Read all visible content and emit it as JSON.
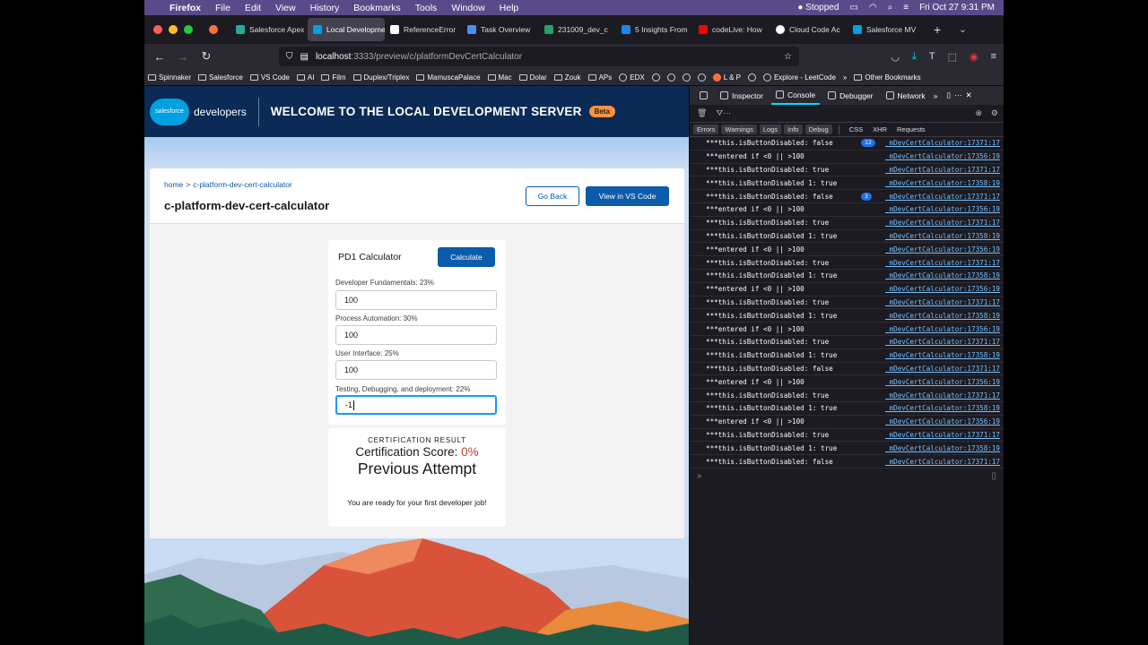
{
  "menubar": {
    "app": "Firefox",
    "items": [
      "File",
      "Edit",
      "View",
      "History",
      "Bookmarks",
      "Tools",
      "Window",
      "Help"
    ],
    "status": "Stopped",
    "clock": "Fri Oct 27  9:31 PM"
  },
  "tabs": [
    {
      "label": "Salesforce Apex",
      "color": "#2aa89b"
    },
    {
      "label": "Local Development",
      "color": "#00a1e0",
      "active": true
    },
    {
      "label": "ReferenceError",
      "color": "#ffffff"
    },
    {
      "label": "Task Overview",
      "color": "#4c8df6"
    },
    {
      "label": "231009_dev_c",
      "color": "#21a366"
    },
    {
      "label": "5 Insights From",
      "color": "#1e88e5"
    },
    {
      "label": "codeLive: How",
      "color": "#ff0000"
    },
    {
      "label": "Cloud Code Ac",
      "color": "#ffffff"
    },
    {
      "label": "Salesforce MV",
      "color": "#00a1e0"
    }
  ],
  "url": {
    "host": "localhost",
    "rest": ":3333/preview/c/platformDevCertCalculator"
  },
  "bookmarks": [
    "Spinnaker",
    "Salesforce",
    "VS Code",
    "AI",
    "Film",
    "Duplex/Triplex",
    "MamuscaPalace",
    "Mac",
    "Dolar",
    "Zouk",
    "APs",
    "EDX",
    "L & P",
    "Explore - LeetCode",
    "Other Bookmarks"
  ],
  "header": {
    "logo": "salesforce",
    "brand": "developers",
    "welcome": "WELCOME TO THE LOCAL DEVELOPMENT SERVER",
    "beta": "Beta"
  },
  "card": {
    "crumb_home": "home",
    "crumb_page": "c-platform-dev-cert-calculator",
    "title": "c-platform-dev-cert-calculator",
    "go_back": "Go Back",
    "view_vscode": "View in VS Code"
  },
  "calculator": {
    "title": "PD1 Calculator",
    "button": "Calculate",
    "fields": [
      {
        "label": "Developer Fundamentals: 23%",
        "value": "100"
      },
      {
        "label": "Process Automation: 30%",
        "value": "100"
      },
      {
        "label": "User Interface: 25%",
        "value": "100"
      },
      {
        "label": "Testing, Debugging, and deployment: 22%",
        "value": "-1"
      }
    ]
  },
  "result": {
    "heading": "CERTIFICATION RESULT",
    "score_label": "Certification Score:",
    "score_value": "0%",
    "attempt": "Previous Attempt",
    "message": "You are ready for your first developer job!"
  },
  "devtools": {
    "tabs": [
      "Inspector",
      "Console",
      "Debugger",
      "Network"
    ],
    "active_tab": "Console",
    "levels": [
      "Errors",
      "Warnings",
      "Logs",
      "Info",
      "Debug",
      "CSS",
      "XHR",
      "Requests"
    ],
    "logs": [
      {
        "msg": "***this.isButtonDisabled: false",
        "count": "12",
        "src": "_mDevCertCalculator:17371:17"
      },
      {
        "msg": "***entered if <0 || >100",
        "src": "_mDevCertCalculator:17356:19"
      },
      {
        "msg": "***this.isButtonDisabled: true",
        "src": "_mDevCertCalculator:17371:17"
      },
      {
        "msg": "***this.isButtonDisabled 1: true",
        "src": "_mDevCertCalculator:17358:19"
      },
      {
        "msg": "***this.isButtonDisabled: false",
        "count": "3",
        "src": "_mDevCertCalculator:17371:17"
      },
      {
        "msg": "***entered if <0 || >100",
        "src": "_mDevCertCalculator:17356:19"
      },
      {
        "msg": "***this.isButtonDisabled: true",
        "src": "_mDevCertCalculator:17371:17"
      },
      {
        "msg": "***this.isButtonDisabled 1: true",
        "src": "_mDevCertCalculator:17358:19"
      },
      {
        "msg": "***entered if <0 || >100",
        "src": "_mDevCertCalculator:17356:19"
      },
      {
        "msg": "***this.isButtonDisabled: true",
        "src": "_mDevCertCalculator:17371:17"
      },
      {
        "msg": "***this.isButtonDisabled 1: true",
        "src": "_mDevCertCalculator:17358:19"
      },
      {
        "msg": "***entered if <0 || >100",
        "src": "_mDevCertCalculator:17356:19"
      },
      {
        "msg": "***this.isButtonDisabled: true",
        "src": "_mDevCertCalculator:17371:17"
      },
      {
        "msg": "***this.isButtonDisabled 1: true",
        "src": "_mDevCertCalculator:17358:19"
      },
      {
        "msg": "***entered if <0 || >100",
        "src": "_mDevCertCalculator:17356:19"
      },
      {
        "msg": "***this.isButtonDisabled: true",
        "src": "_mDevCertCalculator:17371:17"
      },
      {
        "msg": "***this.isButtonDisabled 1: true",
        "src": "_mDevCertCalculator:17358:19"
      },
      {
        "msg": "***this.isButtonDisabled: false",
        "src": "_mDevCertCalculator:17371:17"
      },
      {
        "msg": "***entered if <0 || >100",
        "src": "_mDevCertCalculator:17356:19"
      },
      {
        "msg": "***this.isButtonDisabled: true",
        "src": "_mDevCertCalculator:17371:17"
      },
      {
        "msg": "***this.isButtonDisabled 1: true",
        "src": "_mDevCertCalculator:17358:19"
      },
      {
        "msg": "***entered if <0 || >100",
        "src": "_mDevCertCalculator:17356:19"
      },
      {
        "msg": "***this.isButtonDisabled: true",
        "src": "_mDevCertCalculator:17371:17"
      },
      {
        "msg": "***this.isButtonDisabled 1: true",
        "src": "_mDevCertCalculator:17358:19"
      },
      {
        "msg": "***this.isButtonDisabled: false",
        "src": "_mDevCertCalculator:17371:17"
      }
    ]
  }
}
